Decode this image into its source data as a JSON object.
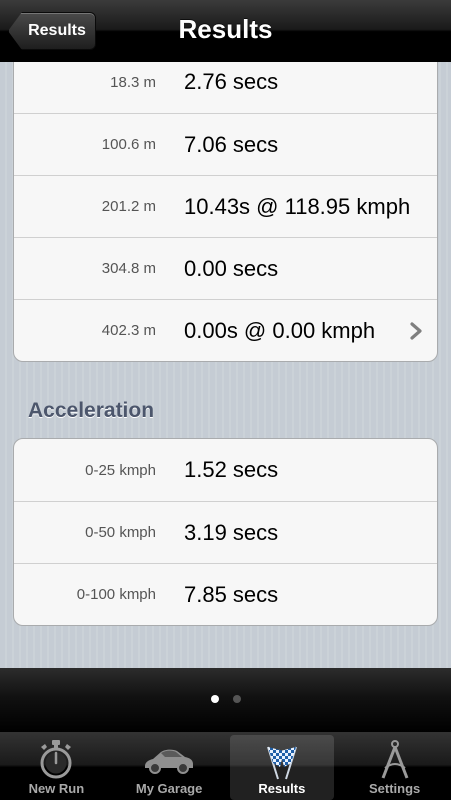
{
  "navbar": {
    "back_label": "Results",
    "title": "Results"
  },
  "distance_results": [
    {
      "label": "18.3 m",
      "value": "2.76 secs",
      "has_chevron": false
    },
    {
      "label": "100.6 m",
      "value": "7.06 secs",
      "has_chevron": false
    },
    {
      "label": "201.2 m",
      "value": "10.43s @ 118.95 kmph",
      "has_chevron": false
    },
    {
      "label": "304.8 m",
      "value": "0.00 secs",
      "has_chevron": false
    },
    {
      "label": "402.3 m",
      "value": "0.00s @ 0.00 kmph",
      "has_chevron": true
    }
  ],
  "acceleration": {
    "header": "Acceleration",
    "rows": [
      {
        "label": "0-25 kmph",
        "value": "1.52 secs"
      },
      {
        "label": "0-50 kmph",
        "value": "3.19 secs"
      },
      {
        "label": "0-100 kmph",
        "value": "7.85 secs"
      }
    ]
  },
  "pager": {
    "page_count": 2,
    "current_page": 1
  },
  "tabbar": {
    "tabs": [
      {
        "label": "New Run",
        "icon": "stopwatch-icon",
        "selected": false
      },
      {
        "label": "My Garage",
        "icon": "car-icon",
        "selected": false
      },
      {
        "label": "Results",
        "icon": "checkered-flags-icon",
        "selected": true
      },
      {
        "label": "Settings",
        "icon": "compass-icon",
        "selected": false
      }
    ]
  },
  "colors": {
    "background": "#c5ccd4",
    "section_header": "#4c566c",
    "cell_background": "#f7f7f7"
  }
}
